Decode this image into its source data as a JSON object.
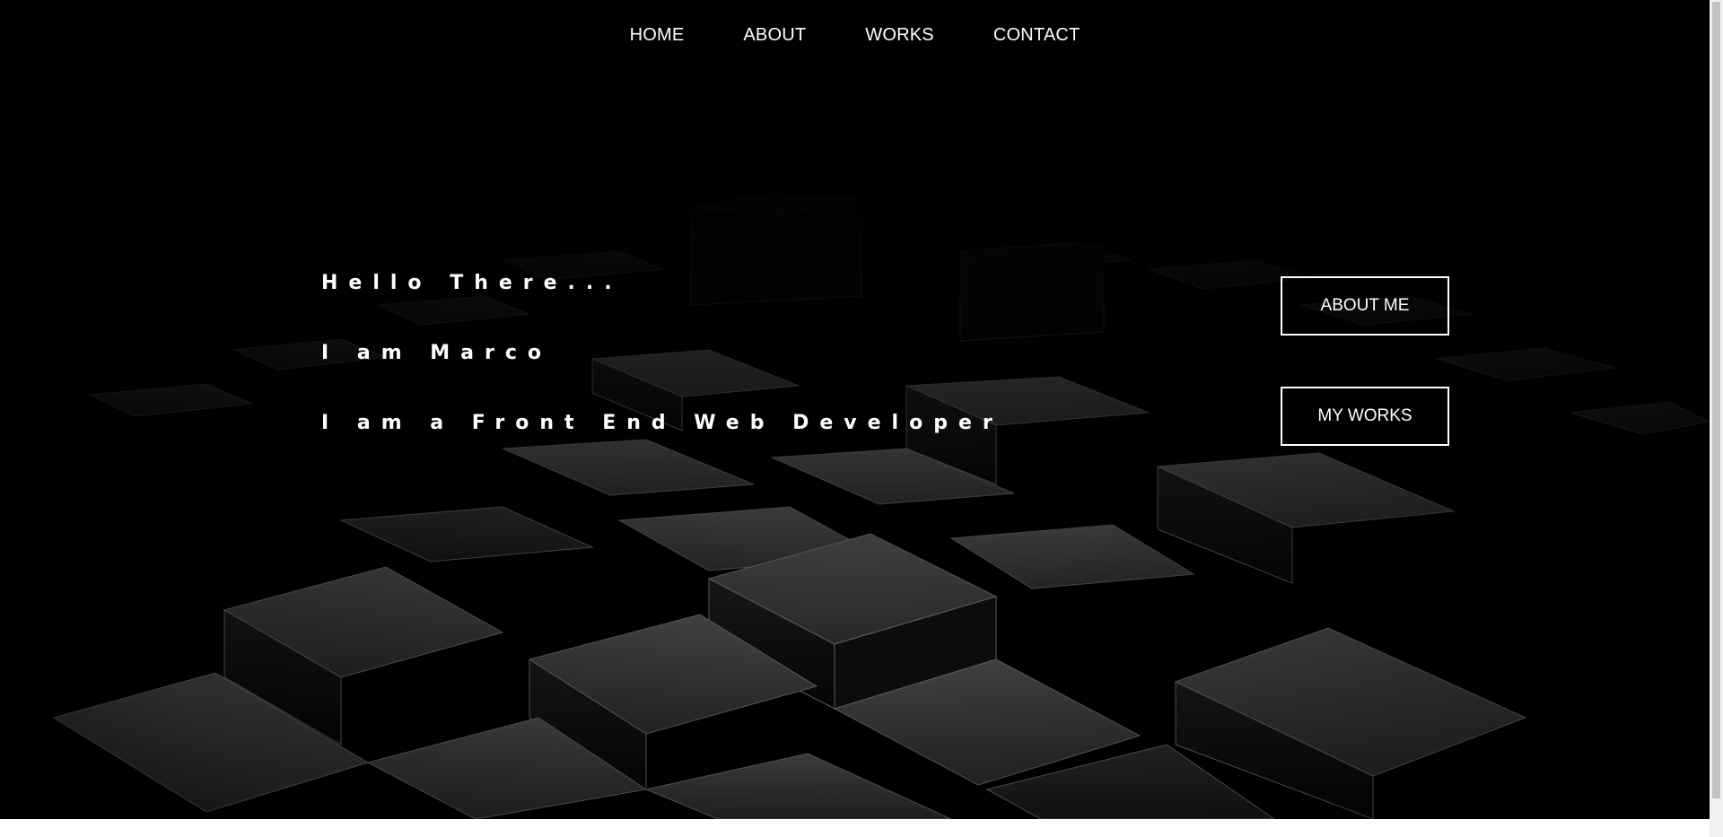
{
  "nav": {
    "items": [
      {
        "label": "HOME"
      },
      {
        "label": "ABOUT"
      },
      {
        "label": "WORKS"
      },
      {
        "label": "CONTACT"
      }
    ]
  },
  "hero": {
    "greeting": "Hello There...",
    "name_line": "I am Marco",
    "role_line": "I am a Front End Web Developer",
    "buttons": {
      "about_me": "ABOUT ME",
      "my_works": "MY WORKS"
    }
  },
  "colors": {
    "background": "#000000",
    "text": "#ffffff",
    "button_border": "#ffffff",
    "page_bottom": "#ffffff"
  },
  "icons": {
    "background_image": "dark-3d-cubes-background"
  }
}
